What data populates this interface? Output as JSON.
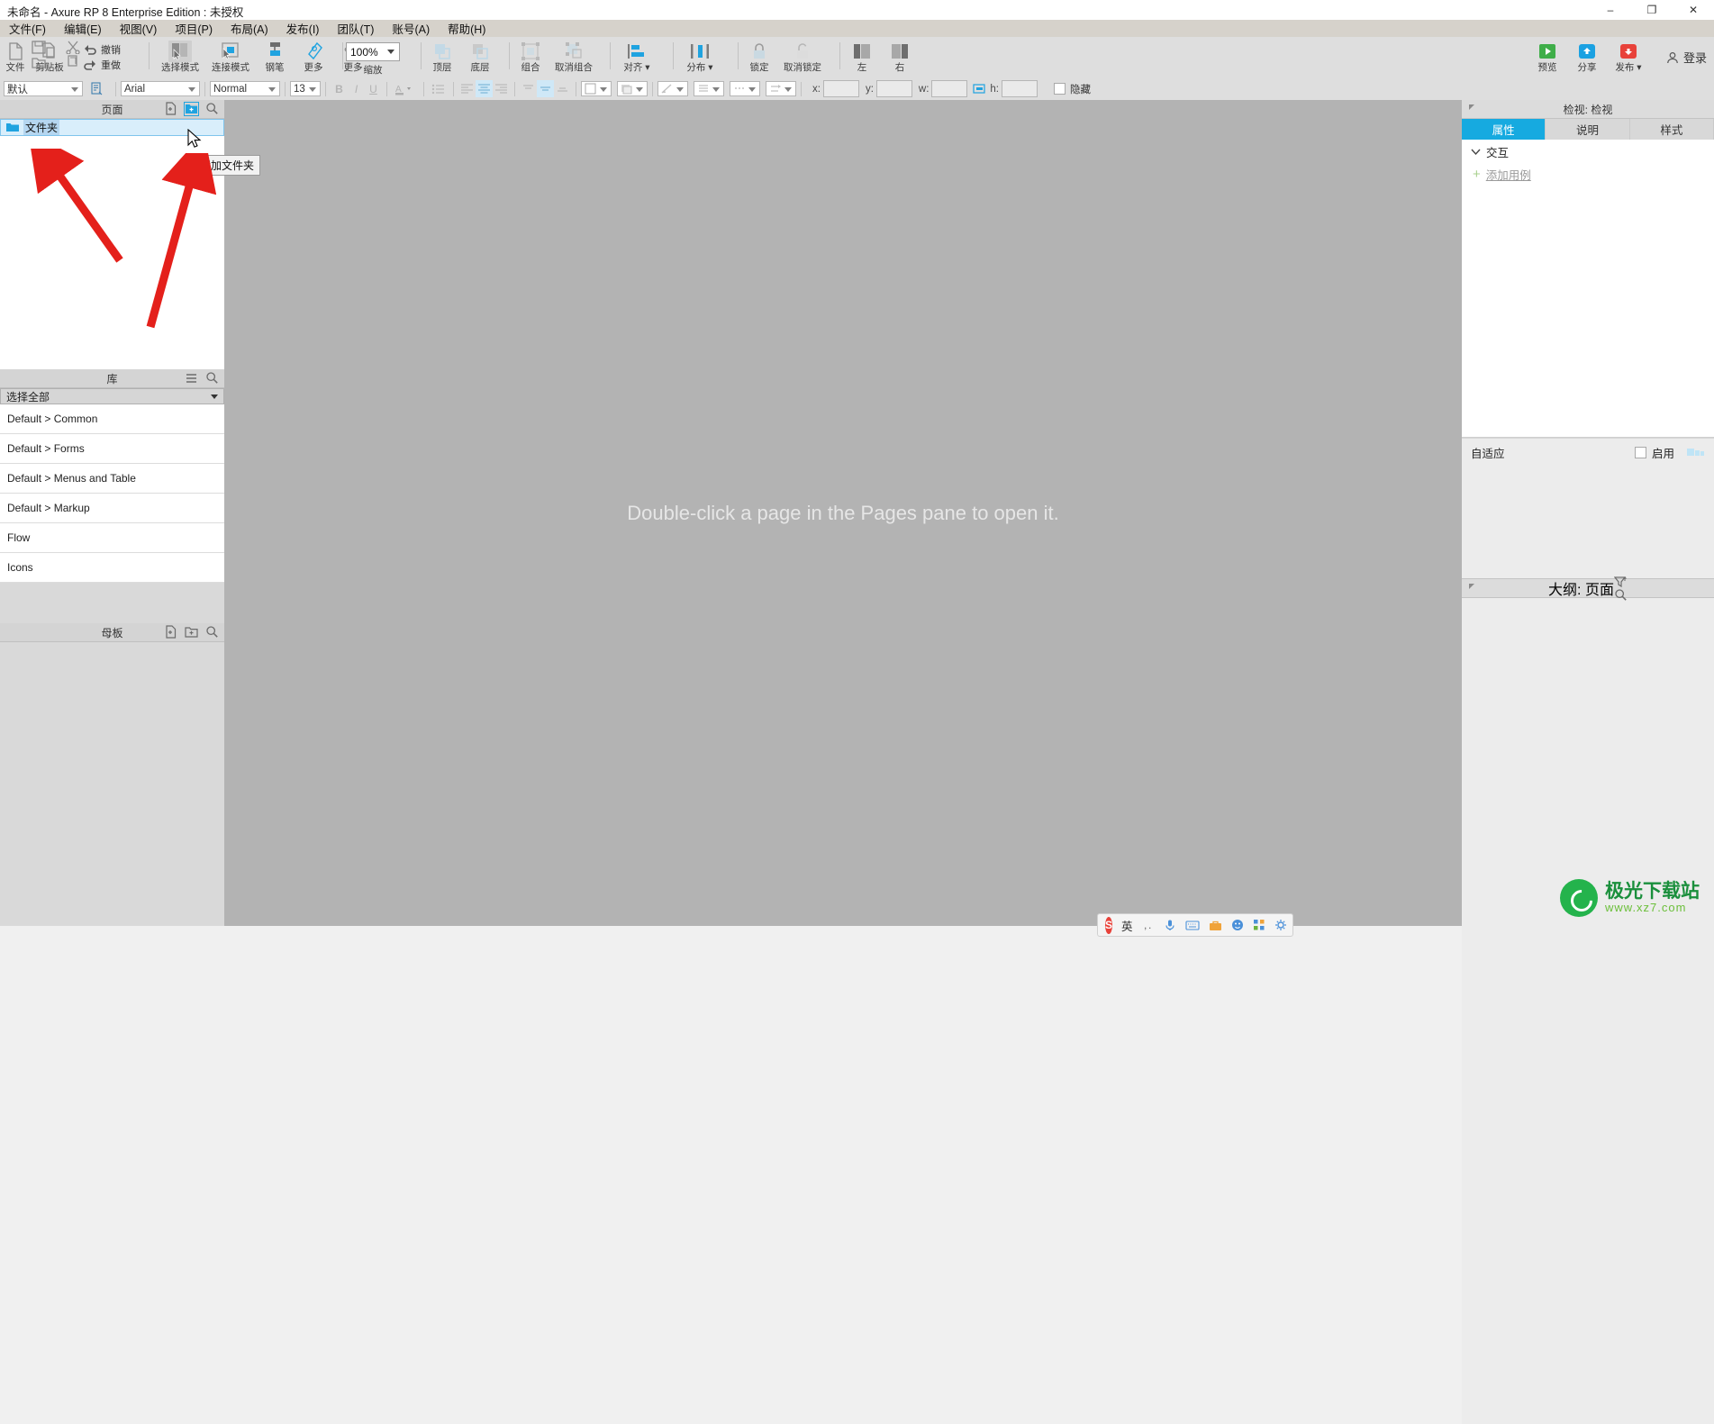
{
  "window": {
    "title": "未命名 - Axure RP 8 Enterprise Edition : 未授权",
    "minimize": "–",
    "maximize": "❐",
    "close": "✕"
  },
  "menubar": {
    "items": [
      {
        "label": "文件(F)"
      },
      {
        "label": "编辑(E)"
      },
      {
        "label": "视图(V)"
      },
      {
        "label": "项目(P)"
      },
      {
        "label": "布局(A)"
      },
      {
        "label": "发布(I)"
      },
      {
        "label": "团队(T)"
      },
      {
        "label": "账号(A)"
      },
      {
        "label": "帮助(H)"
      }
    ]
  },
  "toolbar": {
    "file_label": "文件",
    "clipboard_label": "剪贴板",
    "undo_label": "撤销",
    "redo_label": "重做",
    "select_mode_label": "选择模式",
    "connect_mode_label": "连接模式",
    "pen_label": "钢笔",
    "more_label": "更多",
    "zoom_value": "100%",
    "zoom_label": "缩放",
    "front_label": "顶层",
    "back_label": "底层",
    "group_label": "组合",
    "ungroup_label": "取消组合",
    "align_label": "对齐",
    "distribute_label": "分布",
    "lock_label": "锁定",
    "unlock_label": "取消锁定",
    "left_label": "左",
    "right_label": "右",
    "preview_label": "预览",
    "share_label": "分享",
    "publish_label": "发布",
    "login_label": "登录"
  },
  "formatbar": {
    "widget_style_value": "默认",
    "font_family_value": "Arial",
    "font_weight_value": "Normal",
    "font_size_value": "13",
    "bold_label": "B",
    "italic_label": "I",
    "underline_label": "U",
    "x_label": "x:",
    "y_label": "y:",
    "w_label": "w:",
    "h_label": "h:",
    "x_value": "",
    "y_value": "",
    "w_value": "",
    "h_value": "",
    "hidden_label": "隐藏"
  },
  "pages_panel": {
    "title": "页面",
    "add_page_icon": "add-page-icon",
    "add_folder_icon": "add-folder-icon",
    "search_icon": "search-icon",
    "rows": [
      {
        "label": "文件夹",
        "icon": "folder-icon"
      }
    ],
    "tooltip": "添加文件夹"
  },
  "libraries_panel": {
    "title": "库",
    "menu_icon": "hamburger-icon",
    "search_icon": "search-icon",
    "selector_value": "选择全部",
    "items": [
      {
        "label": "Default > Common"
      },
      {
        "label": "Default > Forms"
      },
      {
        "label": "Default > Menus and Table"
      },
      {
        "label": "Default > Markup"
      },
      {
        "label": "Flow"
      },
      {
        "label": "Icons"
      }
    ]
  },
  "masters_panel": {
    "title": "母板",
    "add_master_icon": "add-master-icon",
    "add_folder_icon": "add-folder-icon",
    "search_icon": "search-icon"
  },
  "canvas": {
    "message": "Double-click a page in the Pages pane to open it."
  },
  "inspector": {
    "title": "检视: 检视",
    "collapse_icon": "collapse-arrow-icon",
    "tabs": [
      {
        "label": "属性",
        "active": true
      },
      {
        "label": "说明",
        "active": false
      },
      {
        "label": "样式",
        "active": false
      }
    ],
    "interaction_section": "交互",
    "add_case_label": "添加用例",
    "adaptive_label": "自适应",
    "enable_label": "启用"
  },
  "outline_panel": {
    "title": "大纲: 页面",
    "filter_icon": "filter-icon",
    "search_icon": "search-icon",
    "collapse_icon": "collapse-arrow-icon"
  },
  "ime_bar": {
    "logo": "S",
    "mode_label": "英",
    "icons": [
      "comma-icon",
      "mic-icon",
      "keyboard-icon",
      "toolbox-icon",
      "emoji-icon",
      "apps-icon",
      "settings-icon"
    ]
  },
  "watermark": {
    "line1": "极光下载站",
    "line2": "www.xz7.com"
  },
  "colors": {
    "accent": "#16aae0",
    "annotation": "#e4201b",
    "canvas_bg": "#b3b3b3",
    "toolbar_bg": "#dedede"
  }
}
